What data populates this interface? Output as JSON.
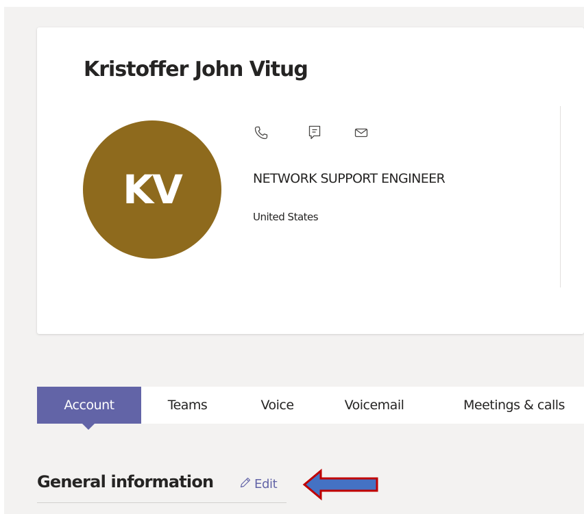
{
  "profile": {
    "name": "Kristoffer John Vitug",
    "initials": "KV",
    "job_title": "NETWORK SUPPORT ENGINEER",
    "location": "United States",
    "avatar_color": "#8e6a1d",
    "contact_icons": [
      "phone-icon",
      "chat-icon",
      "mail-icon"
    ]
  },
  "tabs": [
    {
      "label": "Account",
      "active": true
    },
    {
      "label": "Teams",
      "active": false
    },
    {
      "label": "Voice",
      "active": false
    },
    {
      "label": "Voicemail",
      "active": false
    },
    {
      "label": "Meetings & calls",
      "active": false
    }
  ],
  "general_info": {
    "title": "General information",
    "edit_label": "Edit",
    "edit_icon": "pencil-icon"
  },
  "colors": {
    "accent": "#6264a7",
    "background": "#f3f2f1",
    "annotation_arrow_fill": "#4472c4",
    "annotation_arrow_stroke": "#c00000"
  }
}
